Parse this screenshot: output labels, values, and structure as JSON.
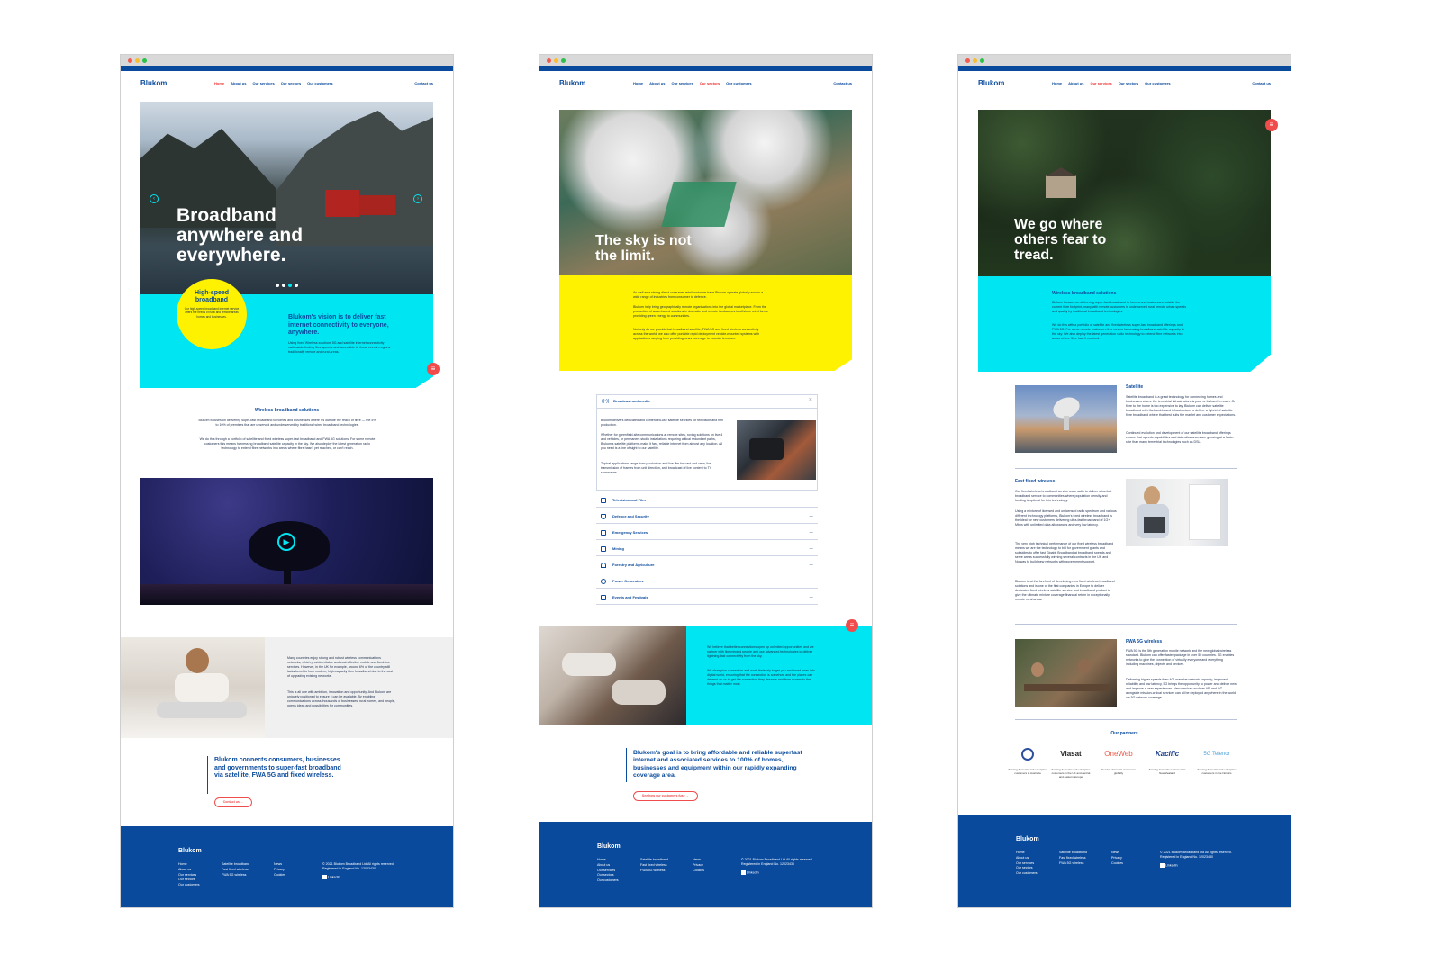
{
  "brand": {
    "logo": "Blukom",
    "blue": "#0a4a9c",
    "cyan": "#00e5f2",
    "yellow": "#fff200",
    "red": "#f04c4c"
  },
  "nav": {
    "home": "Home",
    "about": "About us",
    "services": "Our services",
    "sectors": "Our sectors",
    "customers": "Our customers",
    "contact": "Contact us"
  },
  "page1": {
    "hero_title": "Broadband anywhere and everywhere.",
    "badge_title": "High-speed broadband",
    "badge_text": "Our high-speed broadband internet service offers the needs of rural and remote areas homes and businesses.",
    "vision_title": "Blukom's vision is to deliver fast internet connectivity to everyone, anywhere.",
    "vision_text": "Using fixed Wireless solutions 5G and satellite internet connectivity nationwide finding fibre speeds and accessible to those even in regions traditionally remote and rural areas.",
    "section_title": "Wireless broadband solutions",
    "section_p1": "Blukom focuses on delivering super-fast broadband to homes and businesses where it's outside the reach of fibre — the 5% to 10% of premises that are unserved and underserved by traditional wired broadband technologies.",
    "section_p2": "We do this through a portfolio of satellite and fixed wireless super-fast broadband and FWA 5G solutions. For some remote customers this means harnessing broadband satellite capacity in the sky. We also deploy the latest generation radio technology to extend fibre networks into areas where fibre hasn't yet reached, or can't reach.",
    "girl_p1": "Many countries enjoy strong and robust wireless communications networks, which provide reliable and cost-effective mobile and fixed-line services. However, in the UK for example, around 6% of the country still lacks benefits from modern, high-capacity fibre broadband due to the cost of upgrading existing networks.",
    "girl_p2": "This is all one with ambition, innovation and opportunity. And Blukom are uniquely positioned to ensure it can be available. By enabling communications across thousands of businesses, rural homes, and people, opens ideas and possibilities for communities.",
    "quote": "Blukom connects consumers, businesses and governments to super-fast broadband via satellite, FWA 5G and fixed wireless.",
    "cta": "Contact us"
  },
  "page2": {
    "hero_title": "The sky is not the limit.",
    "yellow_p1": "As well as a strong direct consumer retail customer base Blukom operate globally across a wide range of industries from consumer to defence.",
    "yellow_p2": "Blukom help bring geographically remote organisations into the global marketplace. From the production of wave-based solutions in dramatic and remote landscapes to offshore wind farms providing green energy to communities.",
    "yellow_p3": "Not only do we provide fast broadband satellite, FWA 5G and fixed wireless connectivity across the world, we also offer portable rapid deployment vehicle-mounted systems with applications ranging from providing news coverage to counter terrorism.",
    "open_item": "Broadcast and media",
    "open_p1": "Blukom delivers dedicated and contended-use satellite services for television and film production.",
    "open_p2": "Whether for greenfield-site communications at remote sites, roving solutions on live 4 and vehicles, or permanent studio installations requiring critical redundant paths, Blukom's satellite platforms make it fast, reliable internet from almost any location. All you need is a line of sight to our satellite.",
    "open_p3": "Typical applications range from production and live film for cast and crew, live transmission of frames from unit direction, and broadcast of live content to TV showcases.",
    "accordion": [
      "Television and Film",
      "Defence and Security",
      "Emergency Services",
      "Mining",
      "Forestry and Agriculture",
      "Power Generators",
      "Events and Festivals"
    ],
    "cyan_p1": "We believe that better connections open up unlimited opportunities and we partner with like-minded people and use advanced technologies to deliver lightning-fast connectivity from the sky.",
    "cyan_p2": "We champion connection and work tirelessly to get you and loved ones into digital world, ensuring that the connection is somehow and the places can depend on us to get the connection they deserve and from access to the things that matter most.",
    "quote": "Blukom's goal is to bring affordable and reliable superfast internet and associated services to 100% of homes, businesses and equipment within our rapidly expanding coverage area.",
    "cta": "See how our customers fuse"
  },
  "page3": {
    "hero_title": "We go where others fear to tread.",
    "cyan_title": "Wireless broadband solutions",
    "cyan_p1": "Blukom focuses on delivering super-fast broadband to homes and businesses outside the current fibre footprint, many with remote customers in underserved rural remote urban speeds and quality by traditional broadband technologies.",
    "cyan_p2": "We do this with a portfolio of satellite and fixed wireless super-fast broadband offerings and FWA 5G. For some remote customers this means harnessing broadband satellite capacity in the sky. We also deploy the latest generation radio technology to extend fibre networks into areas where fibre hasn't reached.",
    "sat_title": "Satellite",
    "sat_p1": "Satellite broadband is a great technology for connecting homes and businesses where the terrestrial infrastructure is poor or its hard to reach. Or fibre to the home is too expensive to lay. Blukom can deliver satellite broadband with Ka-band-based infrastructure to deliver a hybrid of satellite fibre broadband where that best suits the market and customer expectations.",
    "sat_p2": "Continued evolution and development of our satellite broadband offerings ensure that speeds capabilities and data allowances are growing at a faster rate than many terrestrial technologies such as DSL.",
    "fixed_title": "Fast fixed wireless",
    "fixed_p1": "Our fixed wireless broadband service uses radio to deliver ultra-fast broadband service to communities where population density and funding is optimal for this technology.",
    "fixed_p2": "Using a mixture of licensed and unlicensed radio spectrum and various different technology platforms, Blukom's fixed wireless broadband is the ideal for new customers delivering ultra-fast broadband of 1G+ Mbps with unlimited data allowances and very low latency.",
    "fixed_p3": "The very high technical performance of our fixed wireless broadband means we are the technology to bid for government grants and subsidies to offer fast Gigabit Broadband at broadband speeds and serve areas successfully winning several contracts in the UK and Norway to build new networks with government support.",
    "fixed_p4": "Blukom is at the forefront of developing new fixed wireless broadband solutions and is one of the first companies in Europe to deliver dedicated fixed wireless satellite service and broadband product to give the ultimate mixture coverage financial return in exceptionally remote rural areas.",
    "fwa_title": "FWA 5G wireless",
    "fwa_p1": "FWA 5G is the 5th generation mobile network and the new global wireless standard. Blukom can offer faster package in over 50 countries. 5G enables networks to give the connection of virtually everyone and everything including machines, objects and devices.",
    "fwa_p2": "Delivering higher speeds than 4G, massive network capacity, improved reliability and low latency, 5G brings the opportunity to power and deliver new and improve a user experiences. New services such as VR and IoT alongside mission-critical services can all be deployed anywhere in the world via 5G network coverage.",
    "partners_title": "Our partners",
    "partners": [
      {
        "name": "UKSA",
        "caption": "Serving domestic and enterprise customers in Australia"
      },
      {
        "name": "Viasat",
        "caption": "Serving domestic and enterprise customers in the UK and central and eastern Europe"
      },
      {
        "name": "OneWeb",
        "caption": "Serving domestic customers globally"
      },
      {
        "name": "Kacific",
        "caption": "Serving domestic customers in New Zealand"
      },
      {
        "name": "5G Telenor",
        "caption": "Serving domestic and enterprise customers in the Nordics"
      }
    ]
  },
  "footer": {
    "logo": "Blukom",
    "col1": [
      "Home",
      "About us",
      "Our services",
      "Our sectors",
      "Our customers"
    ],
    "col2": [
      "Satellite broadband",
      "Fast fixed wireless",
      "FWA 5G wireless"
    ],
    "col3": [
      "News",
      "Privacy",
      "Cookies"
    ],
    "copyright": "© 2021 Blukom Broadband Ltd All rights reserved. Registered in England No. 12023430",
    "linkedin": "LinkedIn"
  }
}
